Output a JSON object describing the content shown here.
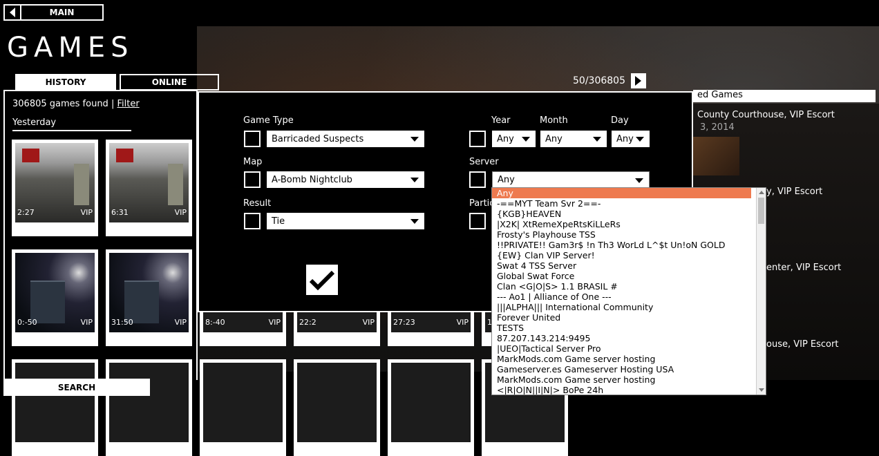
{
  "nav": {
    "main_label": "MAIN"
  },
  "page": {
    "title": "GAMES"
  },
  "tabs": {
    "history": "HISTORY",
    "online": "ONLINE"
  },
  "pager": {
    "text": "50/306805"
  },
  "history": {
    "found_text": "306805 games found",
    "separator": "|",
    "filter_link": "Filter",
    "day_header": "Yesterday",
    "thumbs": [
      {
        "time": "2:27",
        "badge": "VIP",
        "scene": "room"
      },
      {
        "time": "6:31",
        "badge": "VIP",
        "scene": "room"
      },
      {
        "time": "0:-50",
        "badge": "VIP",
        "scene": "house"
      },
      {
        "time": "31:50",
        "badge": "VIP",
        "scene": "house"
      },
      {
        "time": "8:-40",
        "badge": "VIP",
        "scene": "partial"
      },
      {
        "time": "22:2",
        "badge": "VIP",
        "scene": "partial"
      },
      {
        "time": "27:23",
        "badge": "VIP",
        "scene": "partial"
      },
      {
        "time": "1",
        "badge": "",
        "scene": "partial"
      }
    ]
  },
  "search": {
    "label": "SEARCH"
  },
  "right_column": {
    "header": "ed Games",
    "items": [
      "County Courthouse, VIP Escort",
      "y, VIP Escort",
      "enter, VIP Escort",
      "ouse, VIP Escort"
    ],
    "date": "3, 2014"
  },
  "filter": {
    "game_type": {
      "label": "Game Type",
      "value": "Barricaded Suspects"
    },
    "map": {
      "label": "Map",
      "value": "A-Bomb Nightclub"
    },
    "result": {
      "label": "Result",
      "value": "Tie"
    },
    "year": {
      "label": "Year",
      "value": "Any"
    },
    "month": {
      "label": "Month",
      "value": "Any"
    },
    "day": {
      "label": "Day",
      "value": "Any"
    },
    "server": {
      "label": "Server",
      "value": "Any"
    },
    "participant_label": "Partic",
    "apply_icon": "check-icon"
  },
  "server_dropdown": {
    "options": [
      "Any",
      "-==MYT Team Svr 2==-",
      "{KGB}HEAVEN",
      "|X2K| XtRemeXpeRtsKiLLeRs",
      "Frosty's Playhouse TSS",
      "!!PRIVATE!! Gam3r$ !n Th3 WorLd L^$t Un!oN GOLD",
      "{EW} Clan VIP Server!",
      "Swat 4 TSS Server",
      "Global Swat Force",
      "Clan <G|O|S> 1.1 BRASIL #",
      "--- Ao1 | Alliance of One ---",
      "|||ALPHA||| International Community",
      "Forever United",
      "TESTS",
      "87.207.143.214:9495",
      "|UEO|Tactical Server Pro",
      "MarkMods.com Game server hosting",
      "Gameserver.es Gameserver Hosting USA",
      "MarkMods.com Game server hosting",
      "<|R|O|N||I|N|> BoPe 24h"
    ],
    "selected_index": 0,
    "highlight_color": "#ee7a4f"
  }
}
